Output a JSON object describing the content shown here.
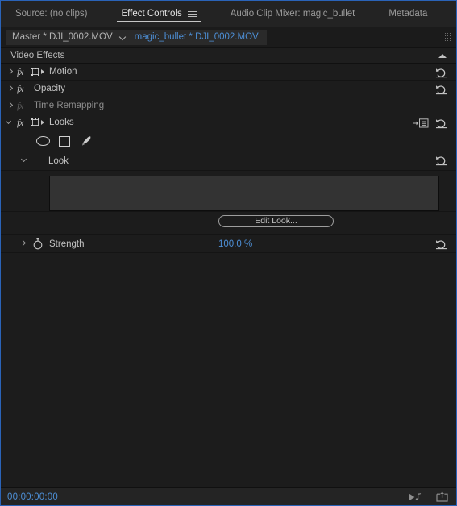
{
  "window": {
    "accent_border": "#2a63b8",
    "background": "#1e1e1e",
    "link_color": "#4d8fd6"
  },
  "tabs": [
    {
      "label": "Source: (no clips)",
      "active": false,
      "has_menu": false
    },
    {
      "label": "Effect Controls",
      "active": true,
      "has_menu": true,
      "menu_icon": "hamburger-menu-icon"
    },
    {
      "label": "Audio Clip Mixer: magic_bullet",
      "active": false,
      "has_menu": false
    },
    {
      "label": "Metadata",
      "active": false,
      "has_menu": false
    }
  ],
  "clip_bar": {
    "master_label": "Master * DJI_0002.MOV",
    "dropdown_icon": "chevron-down-icon",
    "clip_name": "magic_bullet * DJI_0002.MOV",
    "drag_handle_icon": "drag-handle-icon"
  },
  "section": {
    "title": "Video Effects",
    "collapse_icon": "triangle-up-icon"
  },
  "effects": [
    {
      "name": "Motion",
      "fx_icon": "fx-icon",
      "fx_enabled": true,
      "transform_icon": "transform-box-icon",
      "expanded": false,
      "twisty_icon": "chevron-right-icon",
      "reset_icon": "reset-icon",
      "has_effect_list_icon": false
    },
    {
      "name": "Opacity",
      "fx_icon": "fx-icon",
      "fx_enabled": true,
      "transform_icon": null,
      "expanded": false,
      "twisty_icon": "chevron-right-icon",
      "reset_icon": "reset-icon",
      "has_effect_list_icon": false
    },
    {
      "name": "Time Remapping",
      "fx_icon": "fx-icon",
      "fx_enabled": false,
      "transform_icon": null,
      "expanded": false,
      "twisty_icon": "chevron-right-icon",
      "reset_icon": null,
      "has_effect_list_icon": false
    },
    {
      "name": "Looks",
      "fx_icon": "fx-icon",
      "fx_enabled": true,
      "transform_icon": "transform-box-icon",
      "expanded": true,
      "twisty_icon": "chevron-down-icon",
      "reset_icon": "reset-icon",
      "has_effect_list_icon": true,
      "effect_list_icon": "free-draw-bezier-list-icon"
    }
  ],
  "mask_tools": [
    {
      "name": "ellipse-mask",
      "icon": "ellipse-mask-icon"
    },
    {
      "name": "rectangle-mask",
      "icon": "rectangle-mask-icon"
    },
    {
      "name": "free-draw-bezier",
      "icon": "pen-tool-icon"
    }
  ],
  "look": {
    "label": "Look",
    "twisty_icon": "chevron-down-icon",
    "expanded": true,
    "reset_icon": "reset-icon",
    "preview_swatch_color": "#333333",
    "edit_button_label": "Edit Look..."
  },
  "strength": {
    "label": "Strength",
    "twisty_icon": "chevron-right-icon",
    "stopwatch_icon": "stopwatch-keyframe-icon",
    "value": "100.0",
    "unit": "%",
    "reset_icon": "reset-icon"
  },
  "status_bar": {
    "timecode": "00:00:00:00",
    "icons": [
      {
        "name": "play-audio-icon"
      },
      {
        "name": "export-frame-icon"
      }
    ]
  }
}
